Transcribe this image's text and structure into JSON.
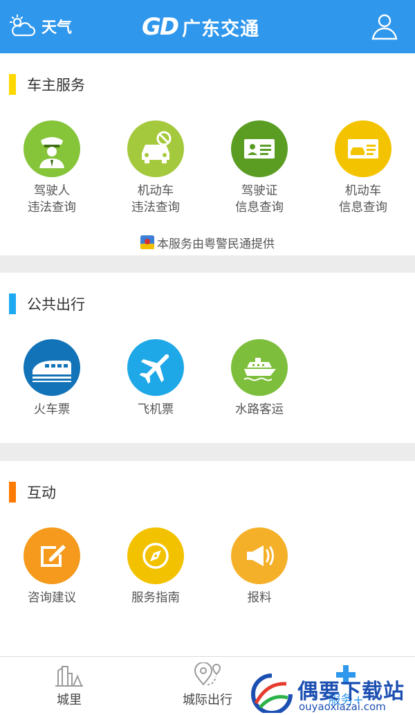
{
  "header": {
    "weather_label": "天气",
    "brand_logo": "GD",
    "brand_title": "广东交通",
    "bg_color": "#2f97ec"
  },
  "sections": {
    "owner": {
      "title": "车主服务",
      "accent": "#ffd800",
      "items": [
        {
          "label": "驾驶人\n违法查询",
          "icon": "traffic-police-icon",
          "color": "#86c43a"
        },
        {
          "label": "机动车\n违法查询",
          "icon": "car-prohibited-icon",
          "color": "#a5c93d"
        },
        {
          "label": "驾驶证\n信息查询",
          "icon": "license-card-icon",
          "color": "#5b9d23"
        },
        {
          "label": "机动车\n信息查询",
          "icon": "vehicle-card-icon",
          "color": "#f4c300"
        }
      ],
      "provider_text": "本服务由粤警民通提供"
    },
    "public": {
      "title": "公共出行",
      "accent": "#1eaaf1",
      "items": [
        {
          "label": "火车票",
          "icon": "train-icon",
          "color": "#1273b8"
        },
        {
          "label": "飞机票",
          "icon": "airplane-icon",
          "color": "#1fa8e8"
        },
        {
          "label": "水路客运",
          "icon": "ship-icon",
          "color": "#7dbf3c"
        }
      ]
    },
    "interact": {
      "title": "互动",
      "accent": "#ff7a00",
      "items": [
        {
          "label": "咨询建议",
          "icon": "edit-icon",
          "color": "#f59a1c"
        },
        {
          "label": "服务指南",
          "icon": "compass-icon",
          "color": "#f2c200"
        },
        {
          "label": "报料",
          "icon": "megaphone-icon",
          "color": "#f5b02a"
        }
      ]
    }
  },
  "bottom_nav": {
    "items": [
      {
        "label": "城里",
        "icon": "city-icon"
      },
      {
        "label": "城际出行",
        "icon": "map-pin-icon"
      },
      {
        "label": "服务+",
        "icon": "plus-icon"
      }
    ]
  },
  "watermark": {
    "text": "偶要下载站",
    "url": "ouyaoxiazai.com"
  }
}
